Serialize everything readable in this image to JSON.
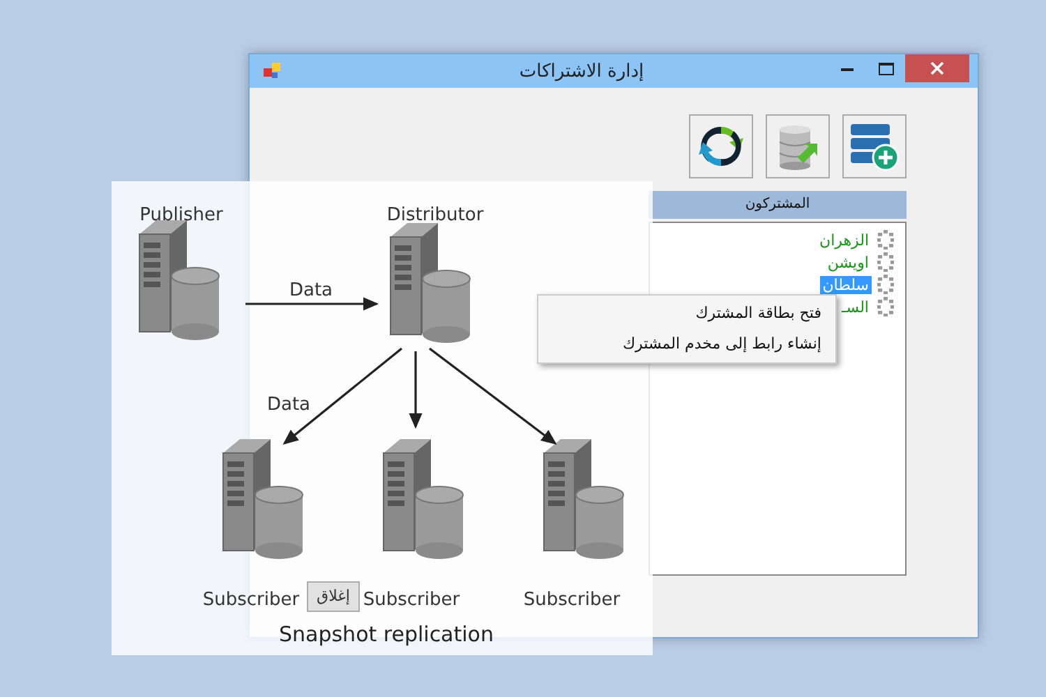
{
  "window": {
    "title": "إدارة الاشتراكات"
  },
  "list_header": "المشتركون",
  "subscribers": [
    {
      "name": "الزهران",
      "selected": false
    },
    {
      "name": "اويشن",
      "selected": false
    },
    {
      "name": "سلطان",
      "selected": true
    },
    {
      "name": "السـ",
      "selected": false
    }
  ],
  "close_button": "إغلاق",
  "context_menu": [
    "فتح بطاقة المشترك",
    "إنشاء رابط إلى مخدم المشترك"
  ],
  "diagram": {
    "title": "Snapshot replication",
    "publisher": "Publisher",
    "distributor": "Distributor",
    "subscriber_1": "Subscriber",
    "subscriber_2": "Subscriber",
    "subscriber_3": "Subscriber",
    "edge_labels": [
      "Data",
      "Data"
    ]
  }
}
